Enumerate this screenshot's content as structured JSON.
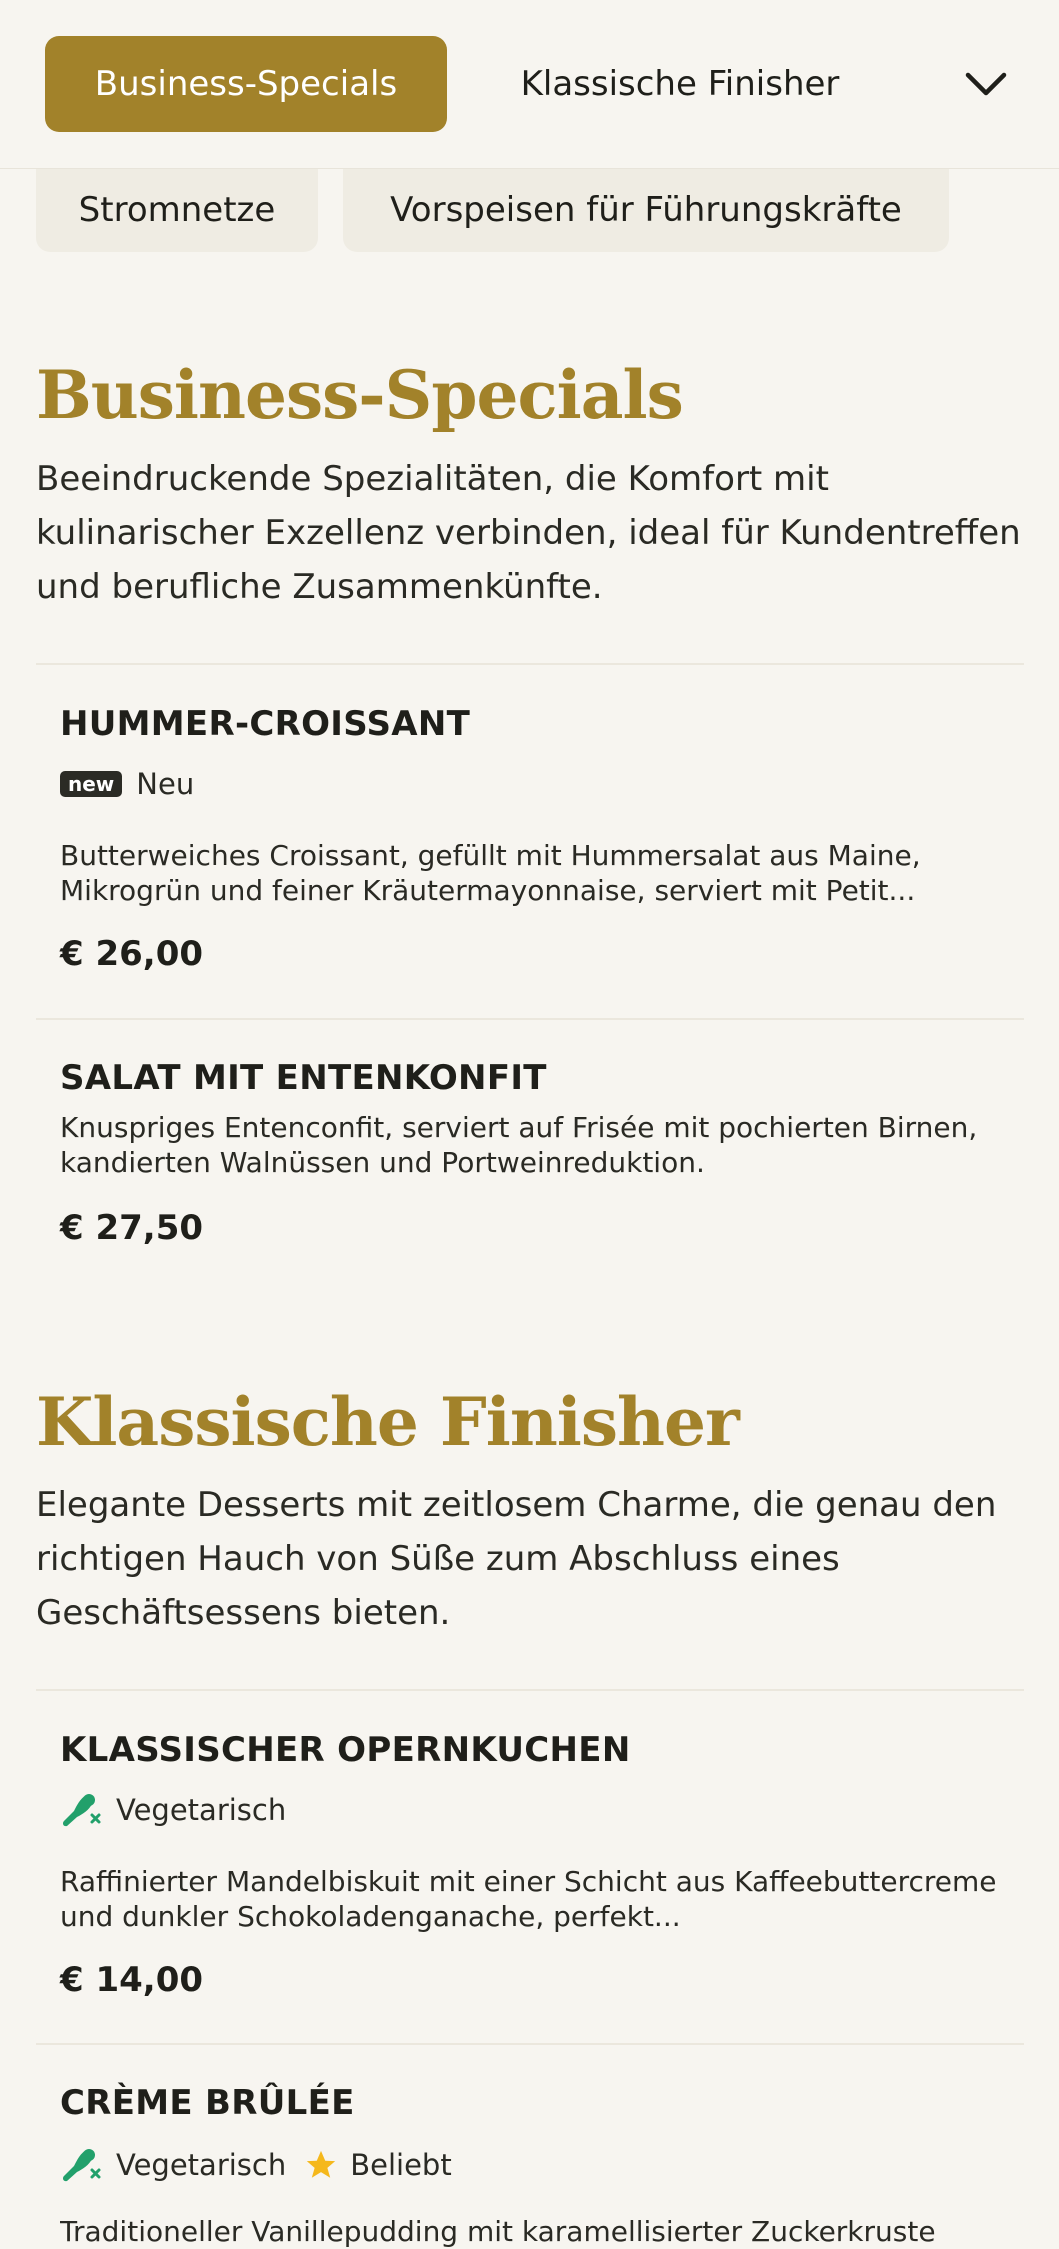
{
  "nav": {
    "active_tab": "Business-Specials",
    "tab_2": "Klassische Finisher",
    "pill_1": "Stromnetze",
    "pill_2": "Vorspeisen für Führungskräfte"
  },
  "sections": [
    {
      "title": "Business-Specials",
      "description": "Beeindruckende Spezialitäten, die Komfort mit kulinarischer Exzellenz verbinden, ideal für Kundentreffen und berufliche Zusammenkünfte.",
      "items": [
        {
          "name": "HUMMER-CROISSANT",
          "badge": "new",
          "tag": "Neu",
          "description": "Butterweiches Croissant, gefüllt mit Hummersalat aus Maine, Mikrogrün und feiner Kräutermayonnaise, serviert mit Petit...",
          "price": "€ 26,00"
        },
        {
          "name": "SALAT MIT ENTENKONFIT",
          "description": "Knuspriges Entenconfit, serviert auf Frisée mit pochierten Birnen, kandierten Walnüssen und Portweinreduktion.",
          "price": "€ 27,50"
        }
      ]
    },
    {
      "title": "Klassische Finisher",
      "description": "Elegante Desserts mit zeitlosem Charme, die genau den richtigen Hauch von Süße zum Abschluss eines Geschäftsessens bieten.",
      "items": [
        {
          "name": "KLASSISCHER OPERNKUCHEN",
          "tag": "Vegetarisch",
          "description": "Raffinierter Mandelbiskuit mit einer Schicht aus Kaffeebuttercreme und dunkler Schokoladenganache, perfekt...",
          "price": "€ 14,00"
        },
        {
          "name": "CRÈME BRÛLÉE",
          "tag": "Vegetarisch",
          "tag_2": "Beliebt",
          "description": "Traditioneller Vanillepudding mit karamellisierter Zuckerkruste"
        }
      ]
    }
  ],
  "colors": {
    "accent": "#a2822a",
    "background": "#f7f5f0",
    "vegetarian_icon": "#22a06b",
    "star": "#f5b81c"
  },
  "icons": [
    "chevron-down-icon",
    "vegetarian-icon",
    "star-icon"
  ]
}
